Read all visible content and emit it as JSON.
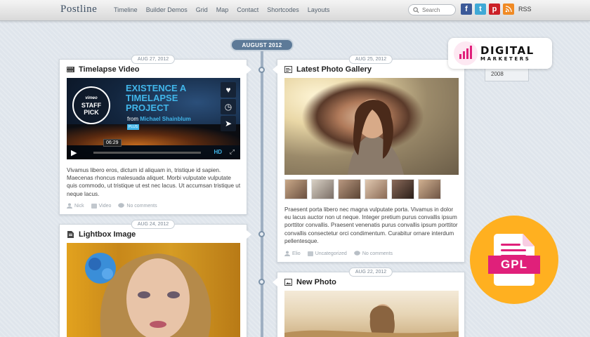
{
  "site": {
    "logo": "Postline"
  },
  "nav": [
    "Timeline",
    "Builder Demos",
    "Grid",
    "Map",
    "Contact",
    "Shortcodes",
    "Layouts"
  ],
  "search": {
    "placeholder": "Search"
  },
  "social": {
    "rss_label": "RSS",
    "icons": [
      "facebook-icon",
      "twitter-icon",
      "pinterest-icon",
      "rss-icon"
    ]
  },
  "timeline": {
    "month": "AUGUST 2012"
  },
  "sidebar": {
    "year": "2008"
  },
  "overlays": {
    "dm_title": "DIGITAL",
    "dm_sub": "MARKETERS",
    "gpl_label": "GPL"
  },
  "posts": [
    {
      "date": "AUG 27, 2012",
      "title": "Timelapse Video",
      "type_icon": "film-icon",
      "video": {
        "badge_top": "vimeo",
        "badge_line1": "STAFF",
        "badge_line2": "PICK",
        "title_line1": "EXISTENCE A",
        "title_line2": "TIMELAPSE",
        "title_line3": "PROJECT",
        "from": "from",
        "author": "Michael Shainblum",
        "plus": "PLUS",
        "time": "06:29",
        "hd": "HD"
      },
      "excerpt": "Vivamus libero eros, dictum id aliquam in, tristique id sapien. Maecenas rhoncus malesuada aliquet. Morbi vulputate vulputate quis commodo, ut tristique ut est nec lacus. Ut accumsan tristique ut neque lacus.",
      "author": "Nick",
      "category": "Video",
      "comments": "No comments"
    },
    {
      "date": "AUG 25, 2012",
      "title": "Latest Photo Gallery",
      "type_icon": "gallery-icon",
      "excerpt": "Praesent porta libero nec magna vulputate porta. Vivamus in dolor eu lacus auctor non ut neque. Integer pretium purus convallis ipsum porttitor convallis. Praesent venenatis purus convallis ipsum porttitor convallis consectetur orci condimentum. Curabitur ornare interdum pellentesque.",
      "author": "Elio",
      "category": "Uncategorized",
      "comments": "No comments"
    },
    {
      "date": "AUG 24, 2012",
      "title": "Lightbox Image",
      "type_icon": "document-icon"
    },
    {
      "date": "AUG 22, 2012",
      "title": "New Photo",
      "type_icon": "image-icon"
    }
  ]
}
